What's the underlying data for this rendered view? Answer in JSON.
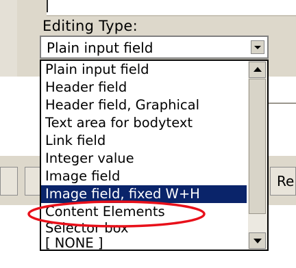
{
  "form": {
    "editing_type_label": "Editing Type:",
    "selected_value": "Plain input field"
  },
  "dropdown": {
    "options": [
      "Plain input field",
      "Header field",
      "Header field, Graphical",
      "Text area for bodytext",
      "Link field",
      "Integer value",
      "Image field",
      "Image field, fixed W+H",
      "Content Elements",
      "Selector box",
      "[ NONE ]"
    ],
    "highlighted_option": "Image field, fixed W+H"
  },
  "background": {
    "partial_button_label": "Re"
  },
  "colors": {
    "selection": "#0a246a",
    "annotation": "#e8101a",
    "panel": "#ddd8cb"
  }
}
